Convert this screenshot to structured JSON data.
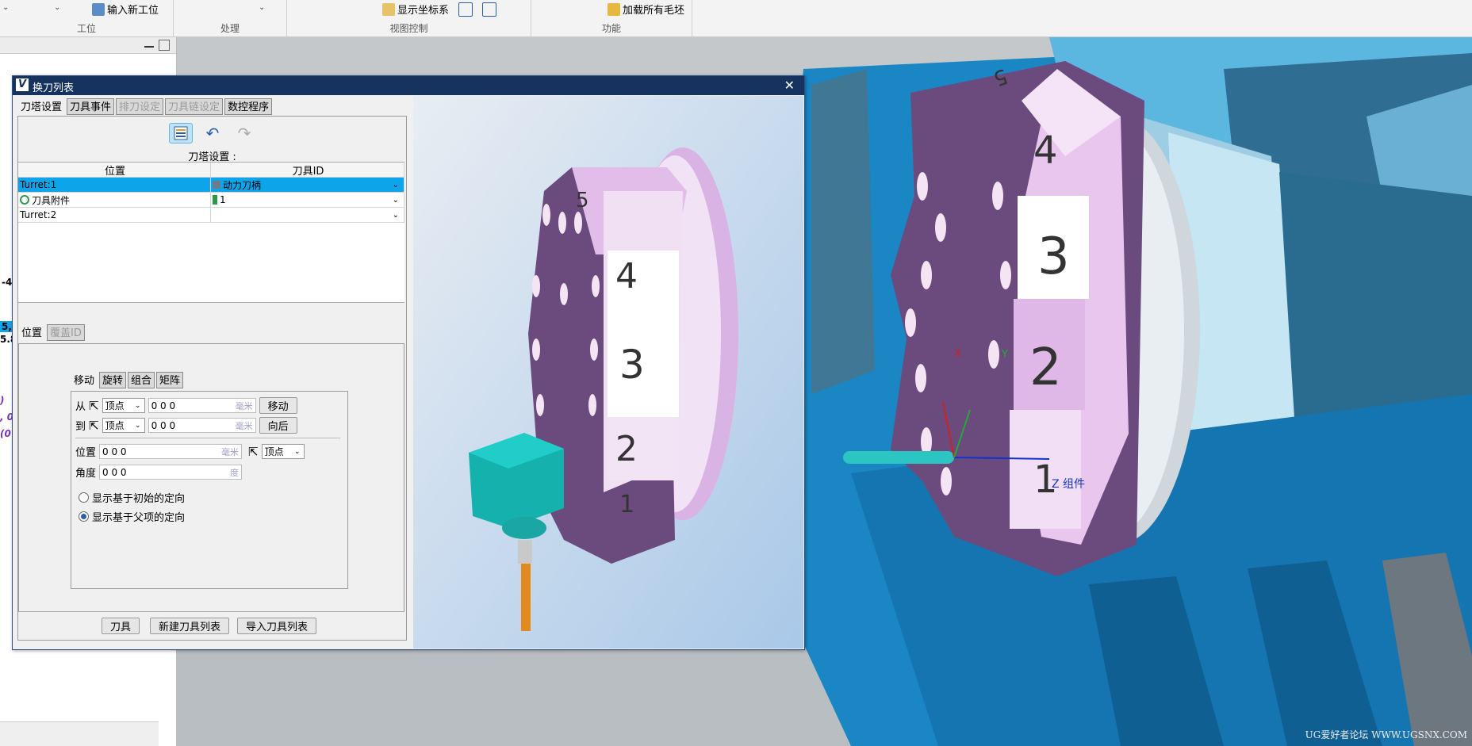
{
  "ribbon": {
    "groups": [
      {
        "label": "工位",
        "button": "输入新工位"
      },
      {
        "label": "处理"
      },
      {
        "label": "视图控制",
        "button": "显示坐标系"
      },
      {
        "label": "功能",
        "button": "加载所有毛坯"
      }
    ]
  },
  "sidebar": {
    "fragments": [
      "-4",
      "5,",
      "5.8",
      ")",
      ", 0",
      "(0"
    ]
  },
  "dialog": {
    "title": "换刀列表",
    "tabs": [
      {
        "label": "刀塔设置",
        "state": "active"
      },
      {
        "label": "刀具事件",
        "state": "normal"
      },
      {
        "label": "排刀设定",
        "state": "disabled"
      },
      {
        "label": "刀具链设定",
        "state": "disabled"
      },
      {
        "label": "数控程序",
        "state": "normal"
      }
    ],
    "toolbar_icons": [
      "list-settings-icon",
      "undo-icon",
      "redo-icon"
    ],
    "grid_caption": "刀塔设置 :",
    "grid": {
      "columns": [
        "位置",
        "刀具ID"
      ],
      "rows": [
        {
          "position": "Turret:1",
          "tool_id": "动力刀柄",
          "selected": true
        },
        {
          "position": "刀具附件",
          "tool_id": "1",
          "selected": false
        },
        {
          "position": "Turret:2",
          "tool_id": "",
          "selected": false
        }
      ]
    },
    "inner_tabs": [
      {
        "label": "位置",
        "state": "active"
      },
      {
        "label": "覆盖ID",
        "state": "disabled"
      }
    ],
    "move_tabs": [
      "移动",
      "旋转",
      "组合",
      "矩阵"
    ],
    "move": {
      "from_label": "从",
      "to_label": "到",
      "from_mode": "顶点",
      "to_mode": "顶点",
      "from_value": "0 0 0",
      "to_value": "0 0 0",
      "unit": "毫米",
      "move_button": "移动",
      "back_button": "向后",
      "position_label": "位置",
      "position_value": "0 0 0",
      "position_mode": "顶点",
      "angle_label": "角度",
      "angle_value": "0 0 0",
      "angle_unit": "度",
      "radio_initial": "显示基于初始的定向",
      "radio_parent": "显示基于父项的定向",
      "radio_selected": "parent"
    },
    "buttons": {
      "tool": "刀具",
      "new_list": "新建刀具列表",
      "import_list": "导入刀具列表"
    }
  },
  "preview": {
    "station_numbers": [
      "5",
      "4",
      "3",
      "2",
      "1"
    ]
  },
  "viewport": {
    "station_numbers": [
      "5",
      "4",
      "3",
      "2",
      "1"
    ],
    "axis_x": "X",
    "axis_y": "Y",
    "axis_z": "Z 组件",
    "watermark": "UG爱好者论坛 WWW.UGSNX.COM"
  }
}
